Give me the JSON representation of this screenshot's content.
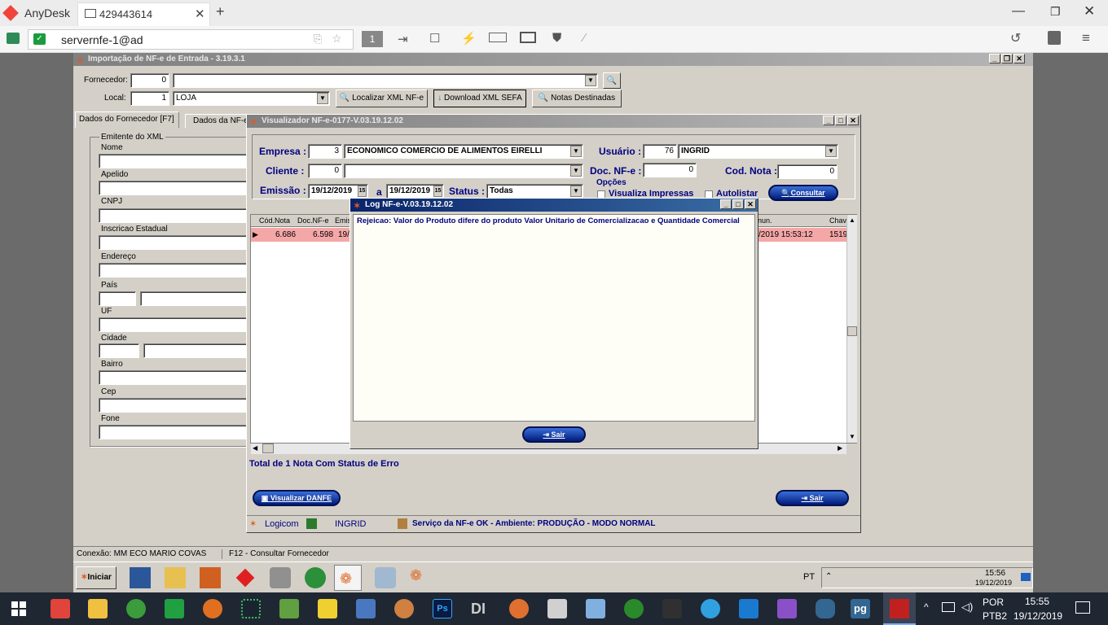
{
  "anydesk": {
    "app_name": "AnyDesk",
    "tab_title": "429443614",
    "address": "servernfe-1@ad",
    "page_number": "1"
  },
  "app": {
    "title": "Importação de NF-e de Entrada - 3.19.3.1",
    "fornecedor_label": "Fornecedor:",
    "fornecedor_value": "0",
    "local_label": "Local:",
    "local_value": "1",
    "local_name": "LOJA",
    "btn_localizar": "Localizar XML NF-e",
    "btn_download": "Download XML SEFA",
    "btn_notas": "Notas Destinadas",
    "tab_fornecedor": "Dados do Fornecedor [F7]",
    "tab_nfe": "Dados da NF-e",
    "group_title": "Emitente do XML",
    "fields": [
      "Nome",
      "Apelido",
      "CNPJ",
      "Inscricao Estadual",
      "Endereço",
      "País",
      "UF",
      "Cidade",
      "Bairro",
      "Cep",
      "Fone"
    ],
    "status_conexao": "Conexão: MM ECO MARIO COVAS",
    "status_f12": "F12 - Consultar Fornecedor"
  },
  "viz": {
    "title": "Visualizador NF-e-0177-V.03.19.12.02",
    "empresa_label": "Empresa :",
    "empresa_code": "3",
    "empresa_name": "ECONOMICO COMERCIO DE ALIMENTOS EIRELLI",
    "usuario_label": "Usuário :",
    "usuario_code": "76",
    "usuario_name": "INGRID",
    "cliente_label": "Cliente :",
    "cliente_code": "0",
    "docnfe_label": "Doc. NF-e :",
    "docnfe_value": "0",
    "codnota_label": "Cod. Nota :",
    "codnota_value": "0",
    "emissao_label": "Emissão :",
    "date_from": "19/12/2019",
    "a_label": "a",
    "date_to": "19/12/2019",
    "status_label": "Status :",
    "status_value": "Todas",
    "opcoes_label": "Opções",
    "chk_visualiza": "Visualiza Impressas",
    "chk_autolistar": "Autolistar",
    "btn_consultar": "Consultar",
    "grid_headers": [
      "Cód.Nota",
      "Doc.NF-e",
      "Emis",
      "nun.",
      "Chav"
    ],
    "grid_row": {
      "cod": "6.686",
      "doc": "6.598",
      "emis": "19/",
      "datetime": "/2019 15:53:12",
      "chave": "1519"
    },
    "total_text": "Total de 1 Nota Com Status de Erro",
    "btn_danfe": "Visualizar DANFE",
    "btn_sair": "Sair",
    "status_logicom": "Logicom",
    "status_user": "INGRID",
    "status_servico": "Serviço da NF-e OK - Ambiente: PRODUÇÃO - MODO NORMAL"
  },
  "log": {
    "title": "Log NF-e-V.03.19.12.02",
    "message": "Rejeicao: Valor do Produto difere do produto Valor Unitario de Comercializacao e Quantidade Comercial",
    "btn_sair": "Sair"
  },
  "xp_taskbar": {
    "start_label": "Iniciar",
    "lang": "PT",
    "time": "15:56",
    "date": "19/12/2019"
  },
  "win_taskbar": {
    "lang_top": "POR",
    "lang_bottom": "PTB2",
    "time": "15:55",
    "date": "19/12/2019"
  },
  "colors": {
    "selected_row": "#f4a7a7",
    "title_gradient": "#808080",
    "pill_blue": "#0a2a9a",
    "status_blue": "#000080"
  }
}
